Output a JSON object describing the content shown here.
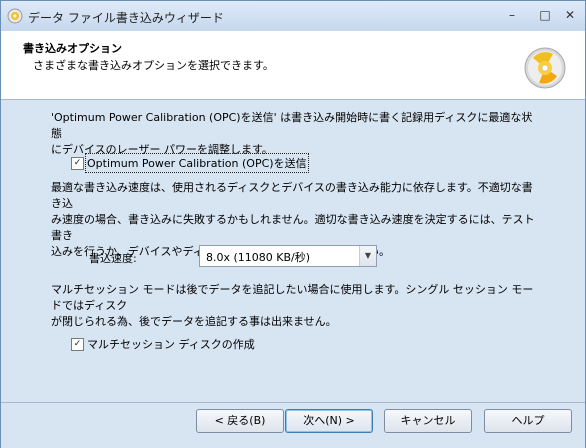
{
  "window": {
    "title": "データ ファイル書き込みウィザード",
    "controls": {
      "minimize": "–",
      "maximize": "□",
      "close": "✕"
    }
  },
  "header": {
    "title": "書き込みオプション",
    "subtitle": "さまざまな書き込みオプションを選択できます。",
    "icon": "cd-disc-icon"
  },
  "content": {
    "opc_description_line1": "'Optimum Power Calibration (OPC)を送信' は書き込み開始時に書く記録用ディスクに最適な状態",
    "opc_description_line2": "にデバイスのレーザー パワーを調整します。",
    "opc_checkbox": {
      "label": "Optimum Power Calibration (OPC)を送信",
      "checked": true
    },
    "speed_description_line1": "最適な書き込み速度は、使用されるディスクとデバイスの書き込み能力に依存します。不適切な書き込",
    "speed_description_line2": "み速度の場合、書き込みに失敗するかもしれません。適切な書き込み速度を決定するには、テスト書き",
    "speed_description_line3": "込みを行うか、デバイスやディスクの製造業者に相談してください。",
    "speed_label": "書込速度:",
    "speed_value": "8.0x (11080 KB/秒)",
    "multisession_description_line1": "マルチセッション モードは後でデータを追記したい場合に使用します。シングル セッション モードではディスク",
    "multisession_description_line2": "が閉じられる為、後でデータを追記する事は出来ません。",
    "multisession_checkbox": {
      "label": "マルチセッション ディスクの作成",
      "checked": true
    }
  },
  "buttons": {
    "back": "< 戻る(B)",
    "next": "次へ(N) >",
    "cancel": "キャンセル",
    "help": "ヘルプ"
  },
  "colors": {
    "body_background": "#d7e4f2",
    "header_background": "#ffffff",
    "default_button_border": "#3c7fb1"
  }
}
